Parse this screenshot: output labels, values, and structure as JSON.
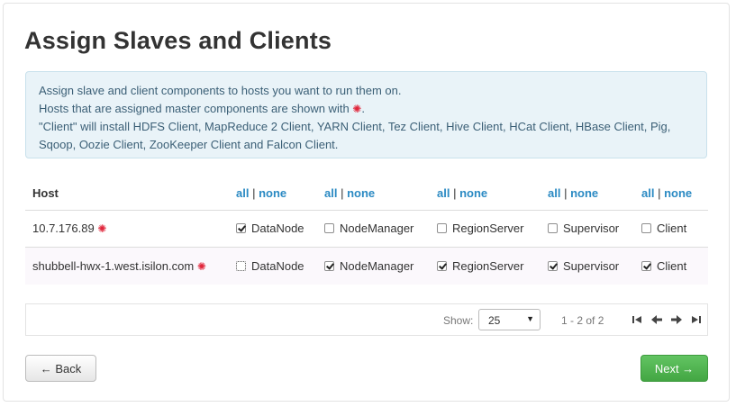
{
  "page": {
    "title": "Assign Slaves and Clients"
  },
  "info": {
    "line1": "Assign slave and client components to hosts you want to run them on.",
    "line2": "Hosts that are assigned master components are shown with",
    "line2_end": ".",
    "line3": "\"Client\" will install HDFS Client, MapReduce 2 Client, YARN Client, Tez Client, Hive Client, HCat Client, HBase Client, Pig, Sqoop, Oozie Client, ZooKeeper Client and Falcon Client.",
    "master_marker": "✺"
  },
  "table": {
    "host_header": "Host",
    "all_label": "all",
    "separator": "|",
    "none_label": "none",
    "rows": [
      {
        "host": "10.7.176.89",
        "master": "✺",
        "components": [
          {
            "label": "DataNode",
            "checked": true
          },
          {
            "label": "NodeManager",
            "checked": false
          },
          {
            "label": "RegionServer",
            "checked": false
          },
          {
            "label": "Supervisor",
            "checked": false
          },
          {
            "label": "Client",
            "checked": false
          }
        ]
      },
      {
        "host": "shubbell-hwx-1.west.isilon.com",
        "master": "✺",
        "components": [
          {
            "label": "DataNode",
            "checked": false
          },
          {
            "label": "NodeManager",
            "checked": true
          },
          {
            "label": "RegionServer",
            "checked": true
          },
          {
            "label": "Supervisor",
            "checked": true
          },
          {
            "label": "Client",
            "checked": true
          }
        ]
      }
    ]
  },
  "pagination": {
    "show_label": "Show:",
    "page_size": "25",
    "range": "1 - 2 of 2",
    "icons": [
      "first-page-icon",
      "prev-page-icon",
      "next-page-icon",
      "last-page-icon"
    ]
  },
  "buttons": {
    "back": "← Back",
    "next": "Next →"
  },
  "colors": {
    "link": "#2b8ac3",
    "marker": "#e0263b",
    "next_button": "#4cae4c",
    "info_bg": "#e9f3f8"
  }
}
